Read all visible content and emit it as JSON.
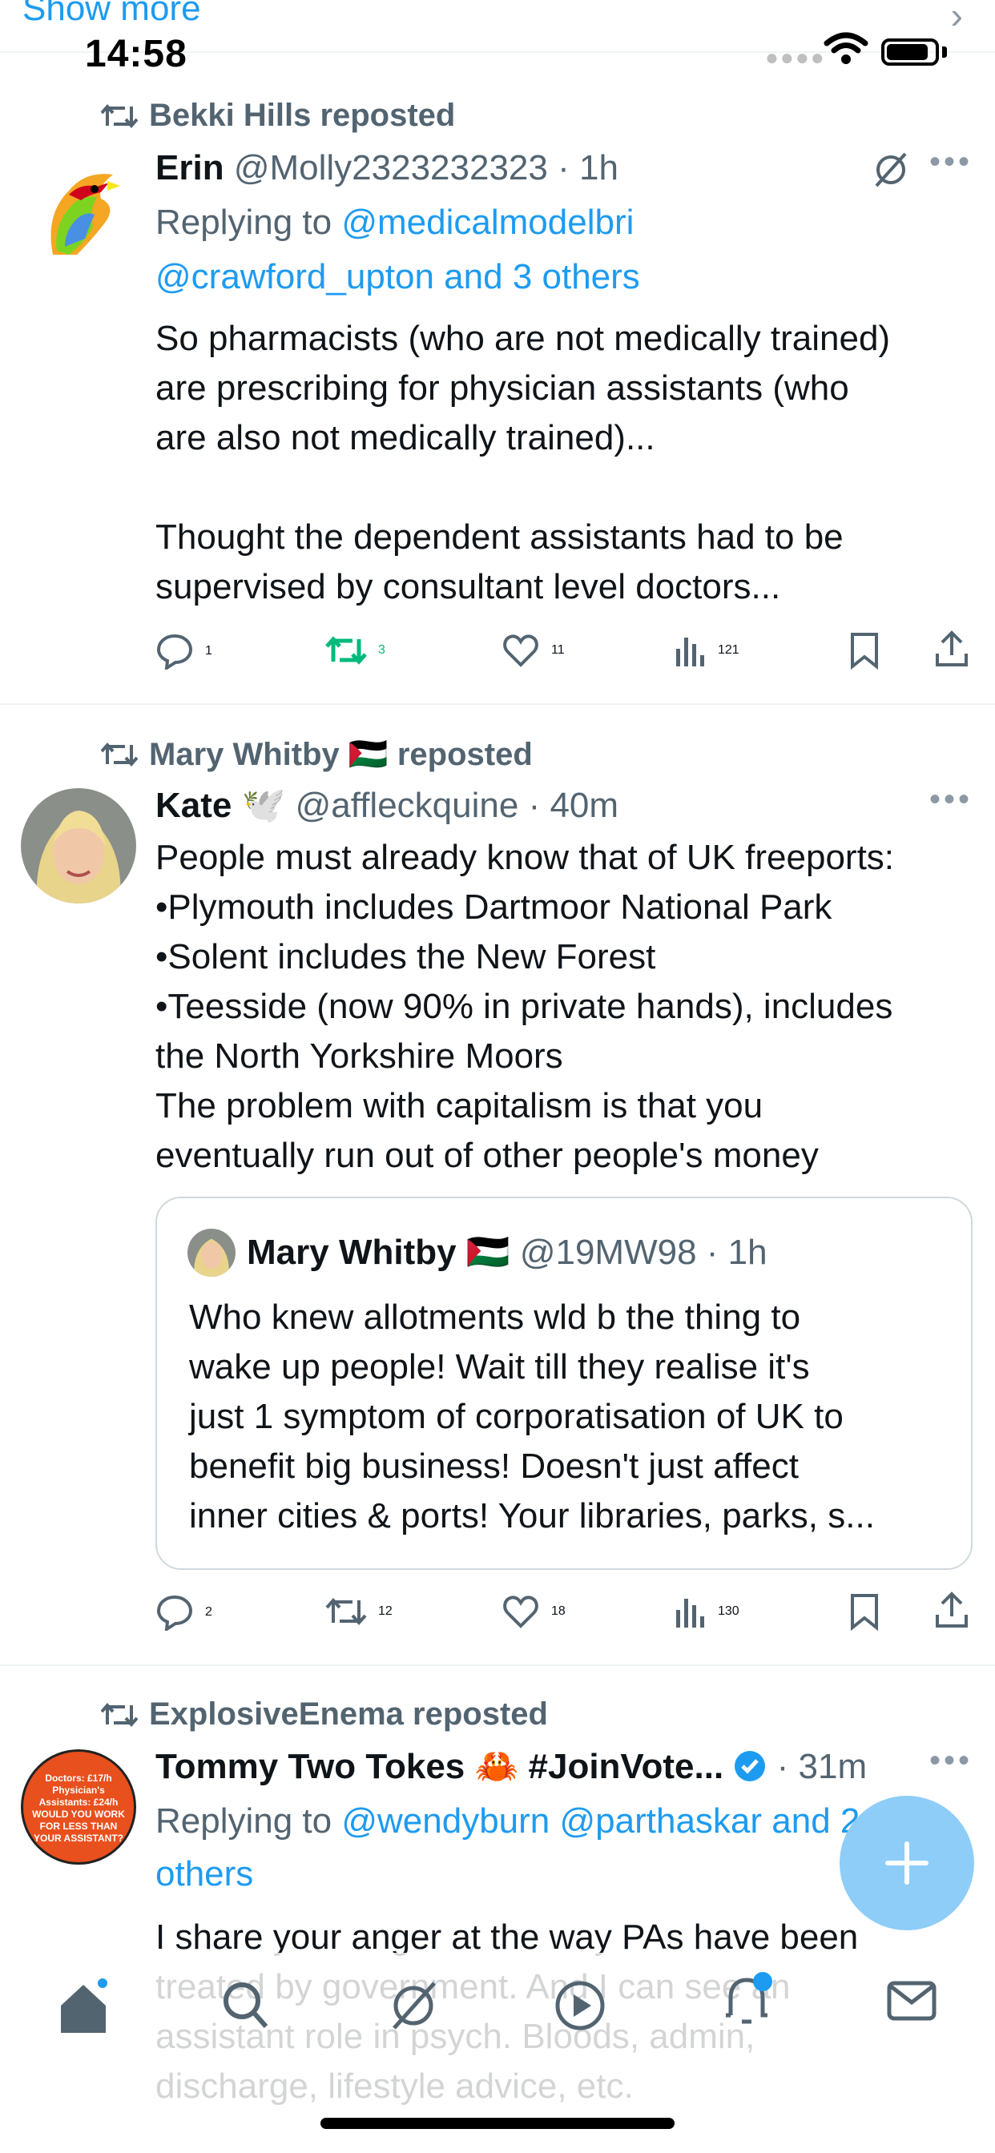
{
  "top": {
    "show_more": "Show more"
  },
  "status_bar": {
    "time": "14:58"
  },
  "tweets": [
    {
      "reposted_by": "Bekki Hills reposted",
      "name": "Erin",
      "handle": "@Molly2323232323",
      "time": "· 1h",
      "replying_prefix": "Replying to ",
      "replying_line1": "@medicalmodelbri",
      "replying_line2": "@crawford_upton and 3 others",
      "text": "So pharmacists (who are not medically trained)\nare prescribing for physician assistants (who\nare also not medically trained)...\n\nThought the dependent assistants had to be\nsupervised by consultant level doctors...",
      "replies": "1",
      "reposts": "3",
      "likes": "11",
      "views": "121"
    },
    {
      "reposted_by": "Mary Whitby 🇵🇸 reposted",
      "name": "Kate 🕊️",
      "handle": "@affleckquine",
      "time": "· 40m",
      "text": "People must already know that of UK freeports:\n•Plymouth includes Dartmoor National Park\n•Solent includes the New Forest\n•Teesside (now 90% in private hands), includes\nthe North Yorkshire Moors\nThe problem with capitalism is that you\neventually run out of other people's money",
      "quote": {
        "name": "Mary Whitby 🇵🇸",
        "handle": "@19MW98",
        "time": "· 1h",
        "text": "Who knew allotments wld b the thing to\nwake up people! Wait till they realise it's\njust 1 symptom of corporatisation of UK to\nbenefit big business! Doesn't just affect\ninner cities & ports! Your libraries, parks, s..."
      },
      "replies": "2",
      "reposts": "12",
      "likes": "18",
      "views": "130"
    },
    {
      "reposted_by": "ExplosiveEnema reposted",
      "name": "Tommy Two Tokes 🦀 #JoinVote...",
      "time": "· 31m",
      "replying_prefix": "Replying to ",
      "replying_line1": "@wendyburn @parthaskar and 2",
      "replying_line2": "others",
      "text": "I share your anger at the way PAs have been\ntreated by government. And I can see an\nassistant role in psych. Bloods, admin,\ndischarge, lifestyle advice, etc.",
      "avatar_text": "Doctors: £17/h\nPhysician's\nAssistants: £24/h\nWOULD YOU WORK\nFOR LESS THAN\nYOUR ASSISTANT?"
    }
  ],
  "colors": {
    "accent": "#1d9bf0",
    "repost_green": "#00ba7c",
    "muted": "#536471"
  }
}
